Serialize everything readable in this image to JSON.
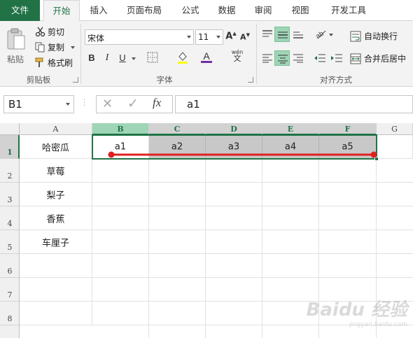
{
  "ribbon": {
    "tabs": [
      {
        "label": "文件",
        "kind": "file"
      },
      {
        "label": "开始",
        "kind": "active"
      },
      {
        "label": "插入",
        "kind": "normal"
      },
      {
        "label": "页面布局",
        "kind": "normal"
      },
      {
        "label": "公式",
        "kind": "normal"
      },
      {
        "label": "数据",
        "kind": "normal"
      },
      {
        "label": "审阅",
        "kind": "normal"
      },
      {
        "label": "视图",
        "kind": "normal"
      },
      {
        "label": "开发工具",
        "kind": "normal"
      }
    ],
    "clipboard": {
      "paste_label": "粘贴",
      "cut_label": "剪切",
      "copy_label": "复制",
      "format_painter_label": "格式刷",
      "group_label": "剪贴板"
    },
    "font": {
      "name_value": "宋体",
      "size_value": "11",
      "bold": "B",
      "italic": "I",
      "underline": "U",
      "font_color_glyph": "A",
      "phonetic_top": "wén",
      "phonetic_bottom": "文",
      "group_label": "字体"
    },
    "alignment": {
      "wrap_label": "自动换行",
      "merge_label": "合并后居中",
      "group_label": "对齐方式"
    },
    "accent_color": "#217346",
    "font_color_bar": "#7030a0"
  },
  "formula_bar": {
    "name_box": "B1",
    "fx_glyph": "fx",
    "cancel_glyph": "✕",
    "enter_glyph": "✓",
    "formula": "a1"
  },
  "grid": {
    "columns": [
      "A",
      "B",
      "C",
      "D",
      "E",
      "F",
      "G"
    ],
    "rows": [
      "1",
      "2",
      "3",
      "4",
      "5",
      "6",
      "7",
      "8"
    ],
    "cells": {
      "A1": "哈密瓜",
      "A2": "草莓",
      "A3": "梨子",
      "A4": "香蕉",
      "A5": "车厘子",
      "B1": "a1",
      "C1": "a2",
      "D1": "a3",
      "E1": "a4",
      "F1": "a5"
    },
    "selection": "B1:F1",
    "annotation_color": "#e02020"
  },
  "watermark": {
    "text": "Baidu 经验",
    "url": "jingyan.baidu.com"
  }
}
